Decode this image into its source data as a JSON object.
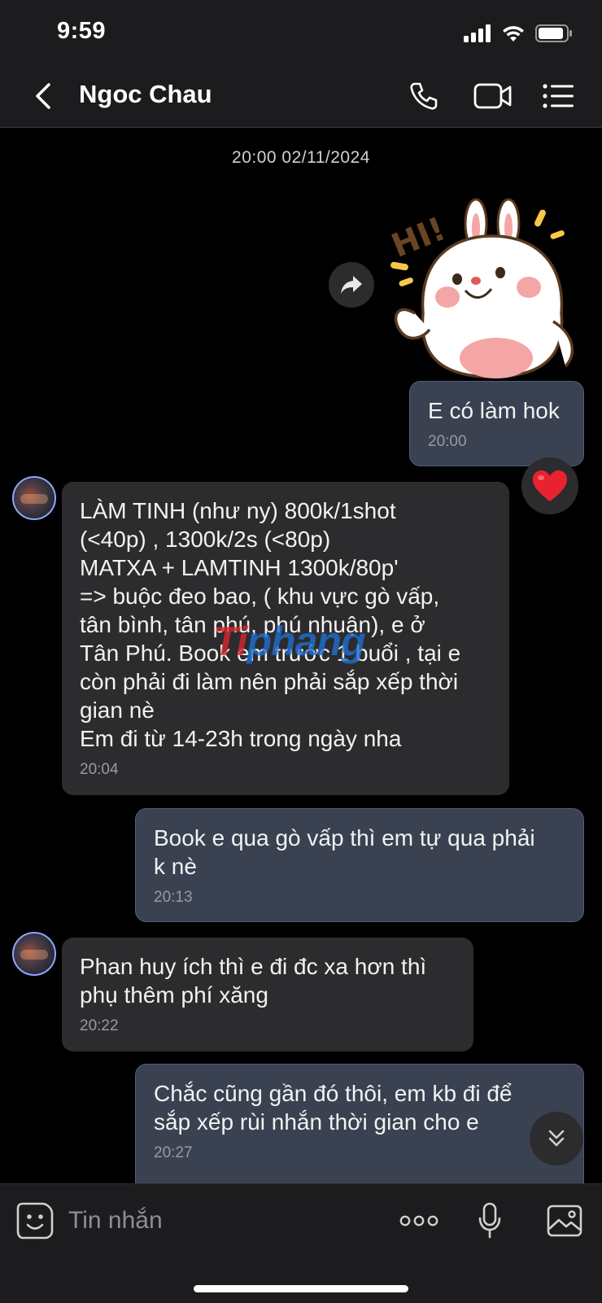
{
  "status_bar": {
    "time": "9:59",
    "icons": [
      "signal-icon",
      "wifi-icon",
      "battery-icon"
    ]
  },
  "header": {
    "contact_name": "Ngoc Chau",
    "actions": [
      "phone-icon",
      "video-call-icon",
      "menu-list-icon"
    ]
  },
  "chat": {
    "date_separator": "20:00 02/11/2024",
    "messages": [
      {
        "direction": "out",
        "text": "E có làm hok",
        "time": "20:00",
        "reaction": "heart"
      },
      {
        "direction": "in",
        "text": "LÀM TINH (như ny) 800k/1shot\n(<40p) , 1300k/2s (<80p)\nMATXA + LAMTINH 1300k/80p'\n=> buộc đeo bao, ( khu vực gò vấp,\ntân bình, tân phú, phú nhuận), e ở\nTân Phú. Book em trước 1 buổi , tại e\ncòn phải đi làm nên phải sắp xếp thời\ngian nè\nEm đi từ 14-23h trong ngày nha",
        "time": "20:04"
      },
      {
        "direction": "out",
        "text": "Book e qua gò vấp thì em tự qua phải\nk nè",
        "time": "20:13"
      },
      {
        "direction": "in",
        "text": "Phan huy ích thì e đi đc xa hơn thì\nphụ thêm phí xăng",
        "time": "20:22"
      },
      {
        "direction": "out",
        "text": "Chắc cũng gần đó thôi, em kb đi để\nsắp xếp rùi nhắn thời gian cho e",
        "time": "20:27"
      }
    ],
    "watermark": {
      "part_a": "Ti",
      "part_b": "phang"
    }
  },
  "input_bar": {
    "placeholder": "Tin nhắn"
  },
  "colors": {
    "outgoing_bubble": "#3a4150",
    "incoming_bubble": "#2c2c2e",
    "bar_background": "#1c1c1e"
  }
}
